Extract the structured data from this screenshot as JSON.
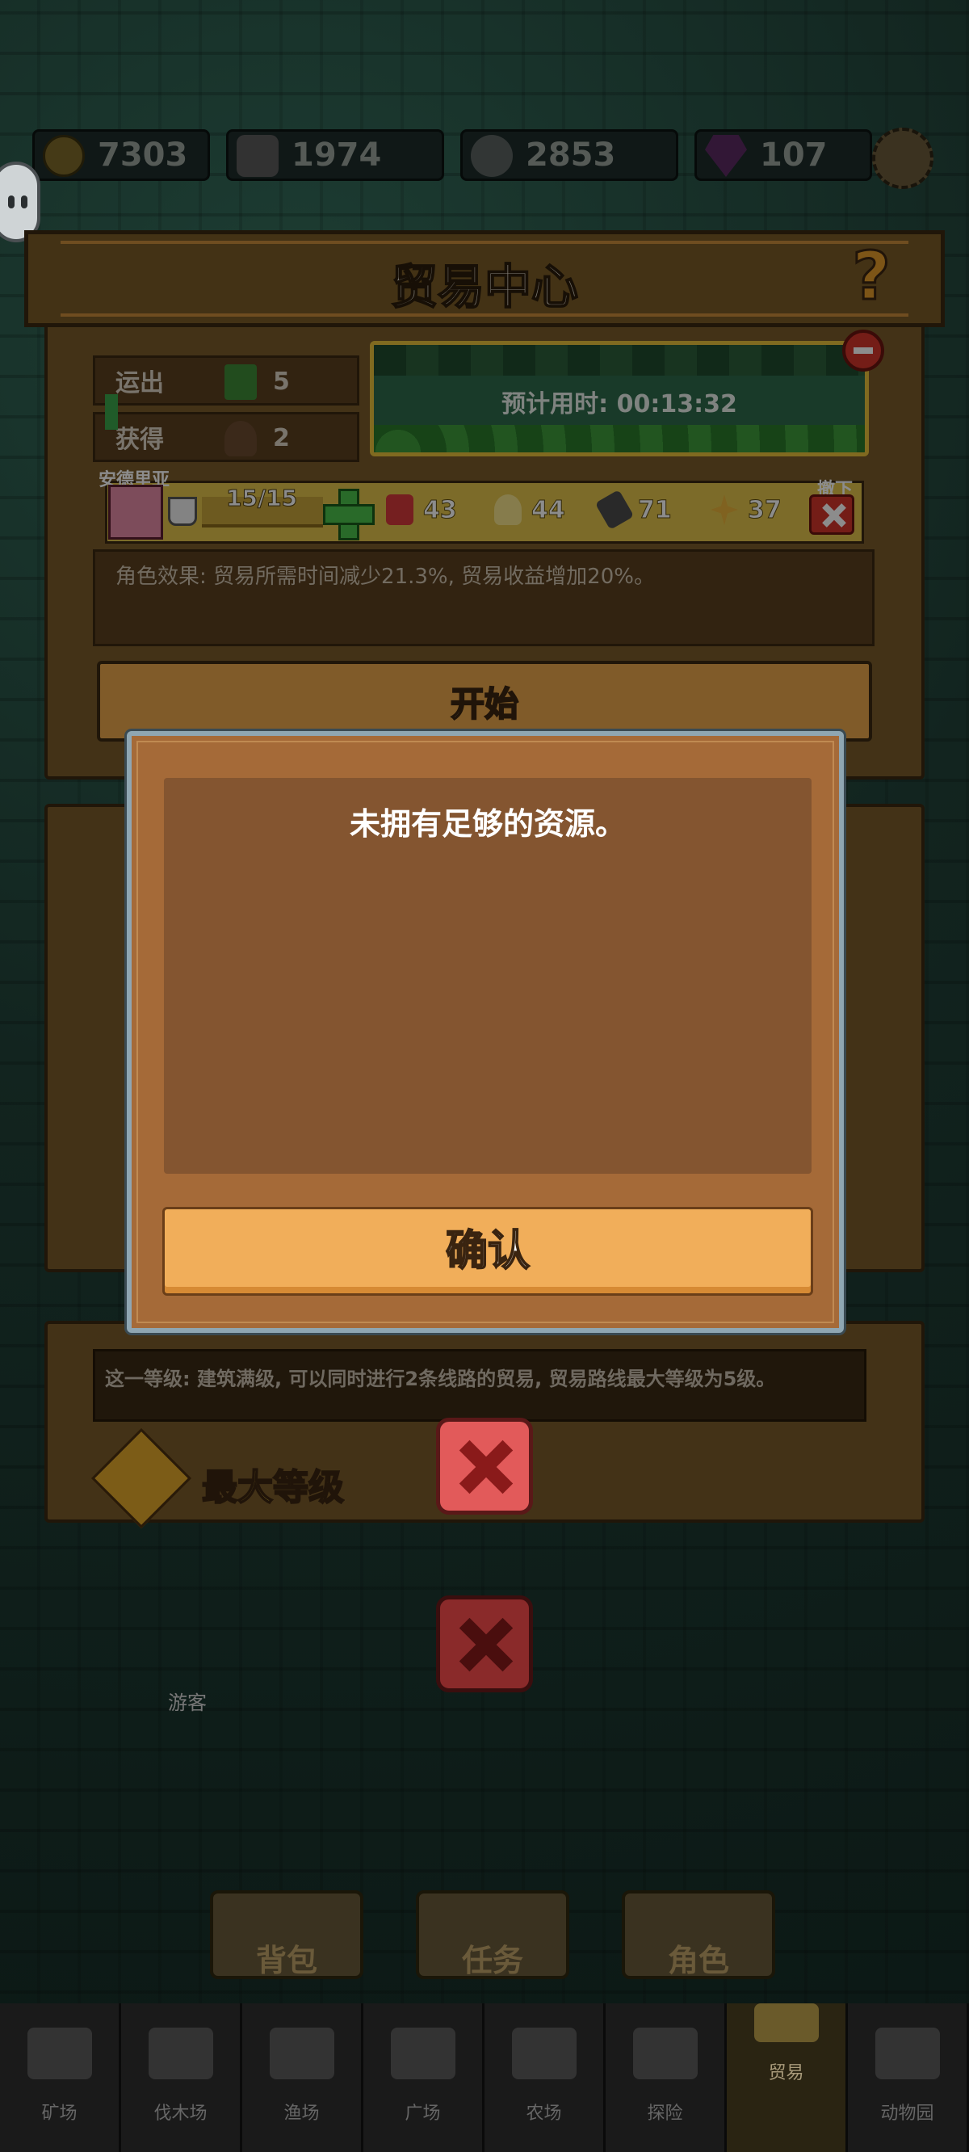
{
  "resources": {
    "gold": "7303",
    "bread": "1974",
    "leaf": "2853",
    "gem": "107"
  },
  "trade_center": {
    "title": "贸易中心",
    "help_symbol": "?",
    "export_label": "运出",
    "export_count": "5",
    "gain_label": "获得",
    "gain_count": "2",
    "estimated_time": "预计用时: 00:13:32",
    "character_name": "安德里亚",
    "stamina": "15/15",
    "stats": [
      "43",
      "44",
      "71",
      "37"
    ],
    "unassign_label": "撤下",
    "character_effect": "角色效果: 贸易所需时间减少21.3%, 贸易收益增加20%。",
    "start_label": "开始"
  },
  "level_panel": {
    "note": "这一等级: 建筑满级, 可以同时进行2条线路的贸易, 贸易路线最大等级为5级。",
    "max_level_label": "最大等级"
  },
  "map_label": "游客",
  "mid_menu": [
    "背包",
    "任务",
    "角色"
  ],
  "tabs": [
    "矿场",
    "伐木场",
    "渔场",
    "广场",
    "农场",
    "探险",
    "贸易",
    "动物园"
  ],
  "dialog": {
    "message": "未拥有足够的资源。",
    "confirm_label": "确认"
  }
}
